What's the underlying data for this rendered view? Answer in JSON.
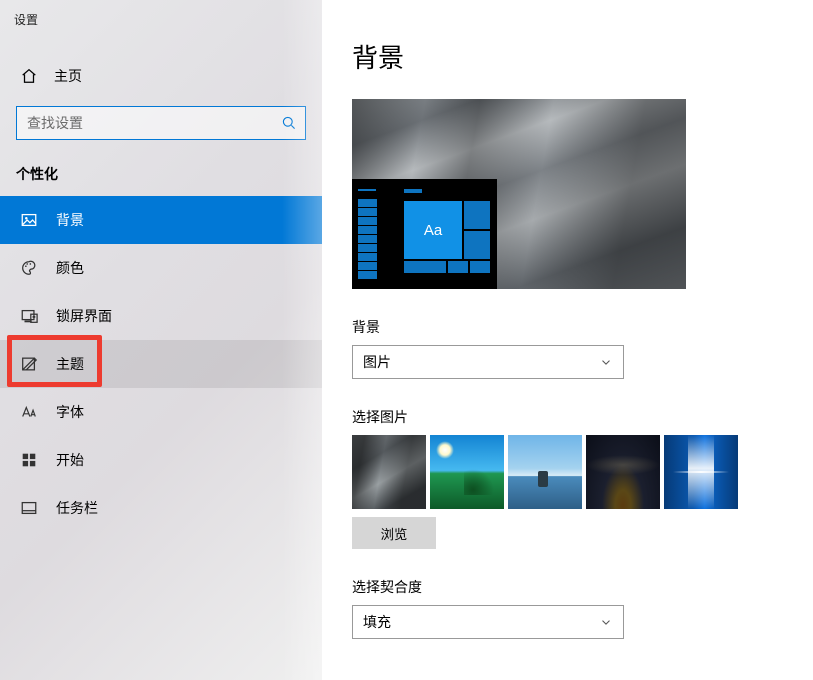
{
  "window_title": "设置",
  "home_label": "主页",
  "search": {
    "placeholder": "查找设置"
  },
  "section_label": "个性化",
  "nav": [
    {
      "label": "背景"
    },
    {
      "label": "颜色"
    },
    {
      "label": "锁屏界面"
    },
    {
      "label": "主题"
    },
    {
      "label": "字体"
    },
    {
      "label": "开始"
    },
    {
      "label": "任务栏"
    }
  ],
  "page_title": "背景",
  "preview_sample_text": "Aa",
  "dropdown1_label": "背景",
  "dropdown1_value": "图片",
  "thumbs_label": "选择图片",
  "browse_label": "浏览",
  "fit_label": "选择契合度",
  "fit_value": "填充"
}
